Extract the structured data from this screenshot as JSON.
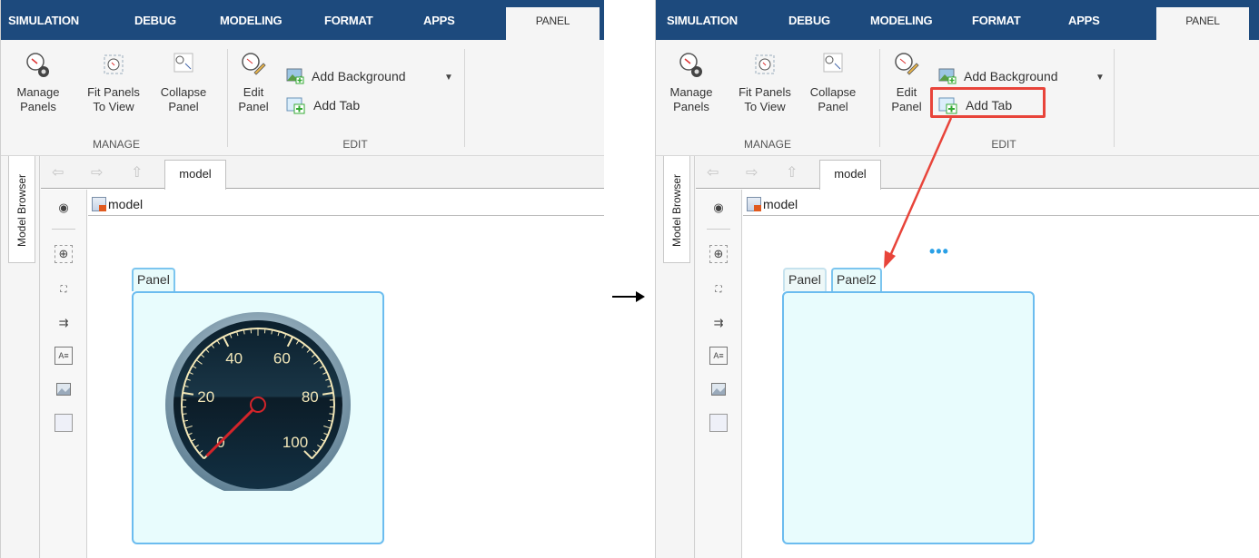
{
  "tabs": [
    "SIMULATION",
    "DEBUG",
    "MODELING",
    "FORMAT",
    "APPS",
    "PANEL"
  ],
  "ribbon": {
    "manage_panels": "Manage\nPanels",
    "manage_panels_l1": "Manage",
    "manage_panels_l2": "Panels",
    "fit_l1": "Fit Panels",
    "fit_l2": "To View",
    "collapse_l1": "Collapse",
    "collapse_l2": "Panel",
    "edit_l1": "Edit",
    "edit_l2": "Panel",
    "add_background": "Add Background",
    "add_tab": "Add Tab",
    "group_manage": "MANAGE",
    "group_edit": "EDIT"
  },
  "side": {
    "model_browser": "Model Browser"
  },
  "editor": {
    "tab": "model",
    "breadcrumb": "model"
  },
  "left": {
    "panel_tab": "Panel"
  },
  "right": {
    "panel_tab_1": "Panel",
    "panel_tab_2": "Panel2",
    "ellipsis": "•••"
  },
  "gauge": {
    "labels": [
      "0",
      "20",
      "40",
      "60",
      "80",
      "100"
    ],
    "value": 0
  },
  "colors": {
    "tab_bar": "#1d4a7d",
    "panel_border": "#6bbcef",
    "panel_fill": "#e8fcfd",
    "highlight": "#e8443a"
  },
  "icons": [
    "manage-panels-icon",
    "fit-panels-icon",
    "collapse-panel-icon",
    "edit-panel-icon",
    "add-background-icon",
    "add-tab-icon",
    "dropdown-arrow-icon",
    "back-arrow-icon",
    "forward-arrow-icon",
    "up-arrow-icon",
    "hide-palette-icon",
    "zoom-icon",
    "fit-to-view-icon",
    "connect-icon",
    "annotation-icon",
    "image-icon",
    "area-icon",
    "model-icon",
    "arrow-right-icon"
  ]
}
